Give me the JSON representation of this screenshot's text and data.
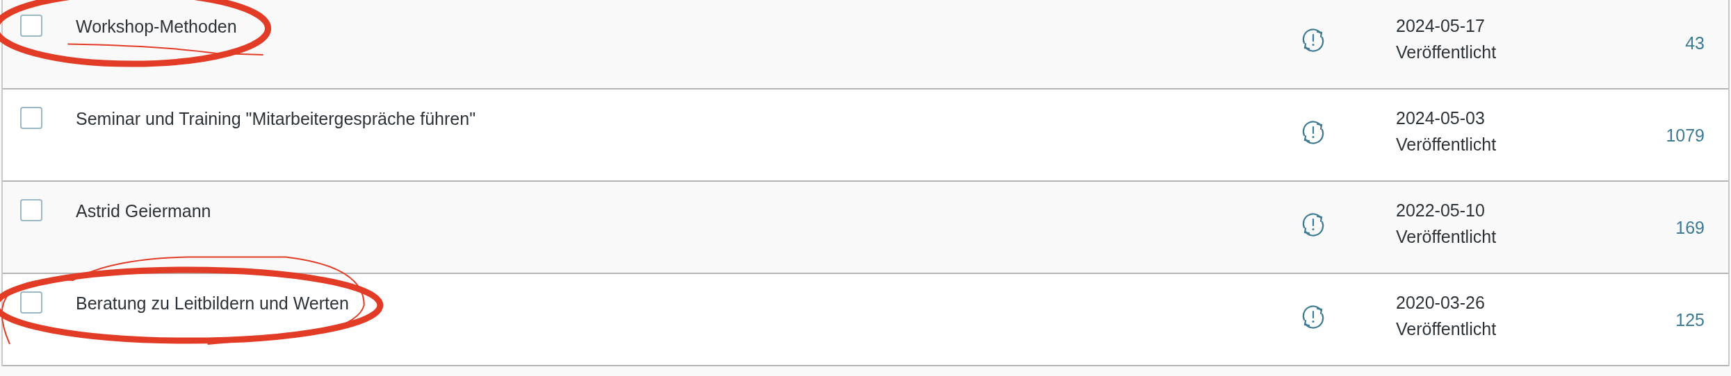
{
  "rows": [
    {
      "title": "Workshop-Methoden",
      "checked": false,
      "date": "2024-05-17",
      "status": "Veröffentlicht",
      "count": "43",
      "circled": true,
      "underlined": true,
      "looped": false
    },
    {
      "title": "Seminar und Training \"Mitarbeitergespräche führen\"",
      "checked": false,
      "date": "2024-05-03",
      "status": "Veröffentlicht",
      "count": "1079",
      "circled": false,
      "underlined": false,
      "looped": false
    },
    {
      "title": "Astrid Geiermann",
      "checked": false,
      "date": "2022-05-10",
      "status": "Veröffentlicht",
      "count": "169",
      "circled": false,
      "underlined": false,
      "looped": false
    },
    {
      "title": "Beratung zu Leitbildern und Werten",
      "checked": false,
      "date": "2020-03-26",
      "status": "Veröffentlicht",
      "count": "125",
      "circled": true,
      "underlined": false,
      "looped": true
    }
  ]
}
